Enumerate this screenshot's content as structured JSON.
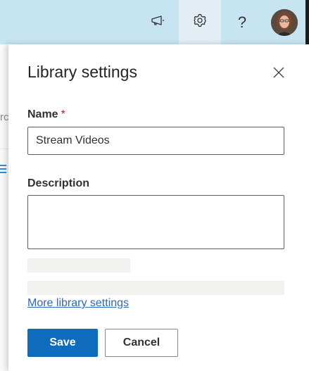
{
  "topbar": {
    "icons": [
      "megaphone-icon",
      "gear-icon",
      "help-icon",
      "avatar"
    ],
    "help_glyph": "?",
    "bg_color": "#c7e4f2"
  },
  "panel": {
    "title": "Library settings",
    "name_label": "Name",
    "required_mark": "*",
    "name_value": "Stream Videos",
    "description_label": "Description",
    "description_value": "",
    "more_link": "More library settings",
    "save_label": "Save",
    "cancel_label": "Cancel",
    "accent_color": "#0f6cbd",
    "link_color": "#2a6ab6"
  },
  "underlay": {
    "fragment_text": "rc"
  }
}
